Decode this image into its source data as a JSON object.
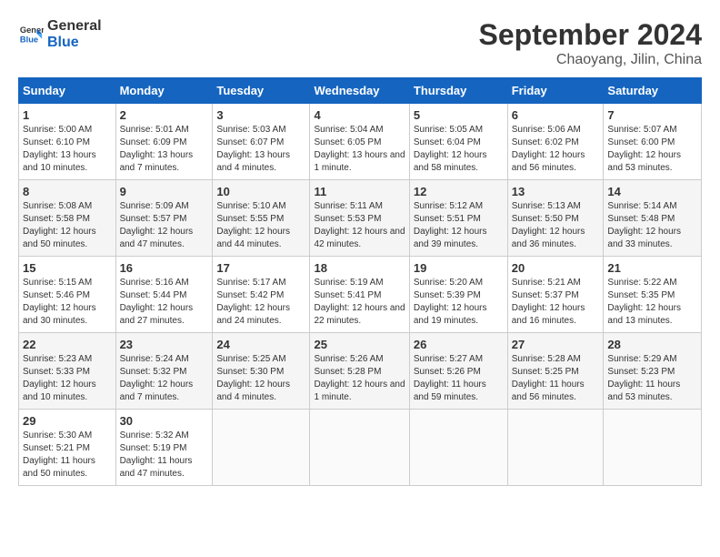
{
  "header": {
    "logo_general": "General",
    "logo_blue": "Blue",
    "month_title": "September 2024",
    "subtitle": "Chaoyang, Jilin, China"
  },
  "days_of_week": [
    "Sunday",
    "Monday",
    "Tuesday",
    "Wednesday",
    "Thursday",
    "Friday",
    "Saturday"
  ],
  "weeks": [
    [
      {
        "day": 1,
        "info": "Sunrise: 5:00 AM\nSunset: 6:10 PM\nDaylight: 13 hours and 10 minutes."
      },
      {
        "day": 2,
        "info": "Sunrise: 5:01 AM\nSunset: 6:09 PM\nDaylight: 13 hours and 7 minutes."
      },
      {
        "day": 3,
        "info": "Sunrise: 5:03 AM\nSunset: 6:07 PM\nDaylight: 13 hours and 4 minutes."
      },
      {
        "day": 4,
        "info": "Sunrise: 5:04 AM\nSunset: 6:05 PM\nDaylight: 13 hours and 1 minute."
      },
      {
        "day": 5,
        "info": "Sunrise: 5:05 AM\nSunset: 6:04 PM\nDaylight: 12 hours and 58 minutes."
      },
      {
        "day": 6,
        "info": "Sunrise: 5:06 AM\nSunset: 6:02 PM\nDaylight: 12 hours and 56 minutes."
      },
      {
        "day": 7,
        "info": "Sunrise: 5:07 AM\nSunset: 6:00 PM\nDaylight: 12 hours and 53 minutes."
      }
    ],
    [
      {
        "day": 8,
        "info": "Sunrise: 5:08 AM\nSunset: 5:58 PM\nDaylight: 12 hours and 50 minutes."
      },
      {
        "day": 9,
        "info": "Sunrise: 5:09 AM\nSunset: 5:57 PM\nDaylight: 12 hours and 47 minutes."
      },
      {
        "day": 10,
        "info": "Sunrise: 5:10 AM\nSunset: 5:55 PM\nDaylight: 12 hours and 44 minutes."
      },
      {
        "day": 11,
        "info": "Sunrise: 5:11 AM\nSunset: 5:53 PM\nDaylight: 12 hours and 42 minutes."
      },
      {
        "day": 12,
        "info": "Sunrise: 5:12 AM\nSunset: 5:51 PM\nDaylight: 12 hours and 39 minutes."
      },
      {
        "day": 13,
        "info": "Sunrise: 5:13 AM\nSunset: 5:50 PM\nDaylight: 12 hours and 36 minutes."
      },
      {
        "day": 14,
        "info": "Sunrise: 5:14 AM\nSunset: 5:48 PM\nDaylight: 12 hours and 33 minutes."
      }
    ],
    [
      {
        "day": 15,
        "info": "Sunrise: 5:15 AM\nSunset: 5:46 PM\nDaylight: 12 hours and 30 minutes."
      },
      {
        "day": 16,
        "info": "Sunrise: 5:16 AM\nSunset: 5:44 PM\nDaylight: 12 hours and 27 minutes."
      },
      {
        "day": 17,
        "info": "Sunrise: 5:17 AM\nSunset: 5:42 PM\nDaylight: 12 hours and 24 minutes."
      },
      {
        "day": 18,
        "info": "Sunrise: 5:19 AM\nSunset: 5:41 PM\nDaylight: 12 hours and 22 minutes."
      },
      {
        "day": 19,
        "info": "Sunrise: 5:20 AM\nSunset: 5:39 PM\nDaylight: 12 hours and 19 minutes."
      },
      {
        "day": 20,
        "info": "Sunrise: 5:21 AM\nSunset: 5:37 PM\nDaylight: 12 hours and 16 minutes."
      },
      {
        "day": 21,
        "info": "Sunrise: 5:22 AM\nSunset: 5:35 PM\nDaylight: 12 hours and 13 minutes."
      }
    ],
    [
      {
        "day": 22,
        "info": "Sunrise: 5:23 AM\nSunset: 5:33 PM\nDaylight: 12 hours and 10 minutes."
      },
      {
        "day": 23,
        "info": "Sunrise: 5:24 AM\nSunset: 5:32 PM\nDaylight: 12 hours and 7 minutes."
      },
      {
        "day": 24,
        "info": "Sunrise: 5:25 AM\nSunset: 5:30 PM\nDaylight: 12 hours and 4 minutes."
      },
      {
        "day": 25,
        "info": "Sunrise: 5:26 AM\nSunset: 5:28 PM\nDaylight: 12 hours and 1 minute."
      },
      {
        "day": 26,
        "info": "Sunrise: 5:27 AM\nSunset: 5:26 PM\nDaylight: 11 hours and 59 minutes."
      },
      {
        "day": 27,
        "info": "Sunrise: 5:28 AM\nSunset: 5:25 PM\nDaylight: 11 hours and 56 minutes."
      },
      {
        "day": 28,
        "info": "Sunrise: 5:29 AM\nSunset: 5:23 PM\nDaylight: 11 hours and 53 minutes."
      }
    ],
    [
      {
        "day": 29,
        "info": "Sunrise: 5:30 AM\nSunset: 5:21 PM\nDaylight: 11 hours and 50 minutes."
      },
      {
        "day": 30,
        "info": "Sunrise: 5:32 AM\nSunset: 5:19 PM\nDaylight: 11 hours and 47 minutes."
      },
      null,
      null,
      null,
      null,
      null
    ]
  ]
}
